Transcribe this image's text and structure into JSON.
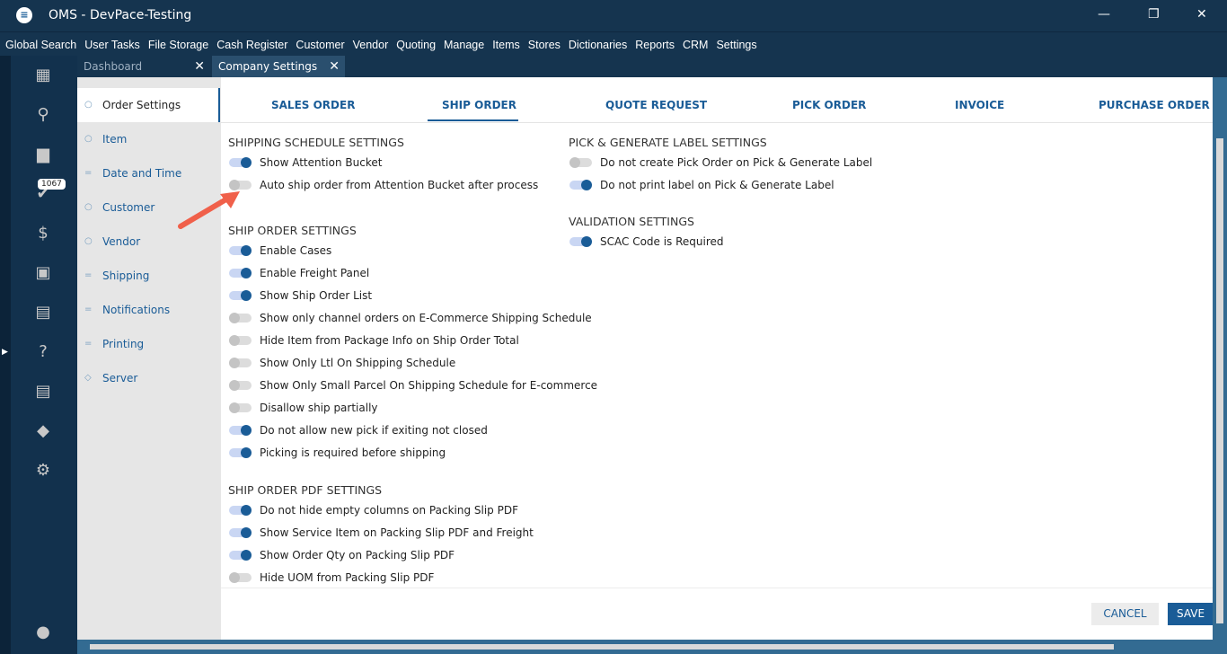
{
  "window": {
    "title": "OMS - DevPace-Testing",
    "minimize": "—",
    "maximize": "❐",
    "close": "✕"
  },
  "menu": [
    "Global Search",
    "User Tasks",
    "File Storage",
    "Cash Register",
    "Customer",
    "Vendor",
    "Quoting",
    "Manage",
    "Items",
    "Stores",
    "Dictionaries",
    "Reports",
    "CRM",
    "Settings"
  ],
  "rail": {
    "badge": "1067"
  },
  "tabs": [
    {
      "label": "Dashboard"
    },
    {
      "label": "Company Settings"
    }
  ],
  "nav": [
    "Order Settings",
    "Item",
    "Date and Time",
    "Customer",
    "Vendor",
    "Shipping",
    "Notifications",
    "Printing",
    "Server"
  ],
  "order_tabs": [
    "SALES ORDER",
    "SHIP ORDER",
    "QUOTE REQUEST",
    "PICK ORDER",
    "INVOICE",
    "PURCHASE ORDER"
  ],
  "sections": {
    "shipping_schedule": {
      "title": "SHIPPING SCHEDULE SETTINGS",
      "items": [
        {
          "label": "Show Attention Bucket",
          "on": true
        },
        {
          "label": "Auto ship order from Attention Bucket after process",
          "on": false
        }
      ]
    },
    "ship_order": {
      "title": "SHIP ORDER SETTINGS",
      "items": [
        {
          "label": "Enable Cases",
          "on": true
        },
        {
          "label": "Enable Freight Panel",
          "on": true
        },
        {
          "label": "Show Ship Order List",
          "on": true
        },
        {
          "label": "Show only channel orders on E-Commerce Shipping Schedule",
          "on": false
        },
        {
          "label": "Hide Item from Package Info on Ship Order Total",
          "on": false
        },
        {
          "label": "Show Only Ltl On Shipping Schedule",
          "on": false
        },
        {
          "label": "Show Only Small Parcel On Shipping Schedule for E-commerce",
          "on": false
        },
        {
          "label": "Disallow ship partially",
          "on": false
        },
        {
          "label": "Do not allow new pick if exiting not closed",
          "on": true
        },
        {
          "label": "Picking is required before shipping",
          "on": true
        }
      ]
    },
    "pdf": {
      "title": "SHIP ORDER PDF SETTINGS",
      "items": [
        {
          "label": "Do not hide empty columns on Packing Slip PDF",
          "on": true
        },
        {
          "label": "Show Service Item on Packing Slip PDF and Freight",
          "on": true
        },
        {
          "label": "Show Order Qty on Packing Slip PDF",
          "on": true
        },
        {
          "label": "Hide UOM from Packing Slip PDF",
          "on": false
        }
      ]
    },
    "pick_label": {
      "title": "PICK & GENERATE LABEL SETTINGS",
      "items": [
        {
          "label": "Do not create Pick Order on Pick & Generate Label",
          "on": false
        },
        {
          "label": "Do not print label on Pick & Generate Label",
          "on": true
        }
      ]
    },
    "validation": {
      "title": "VALIDATION SETTINGS",
      "items": [
        {
          "label": "SCAC Code is Required",
          "on": true
        }
      ]
    }
  },
  "buttons": {
    "cancel": "CANCEL",
    "save": "SAVE"
  }
}
